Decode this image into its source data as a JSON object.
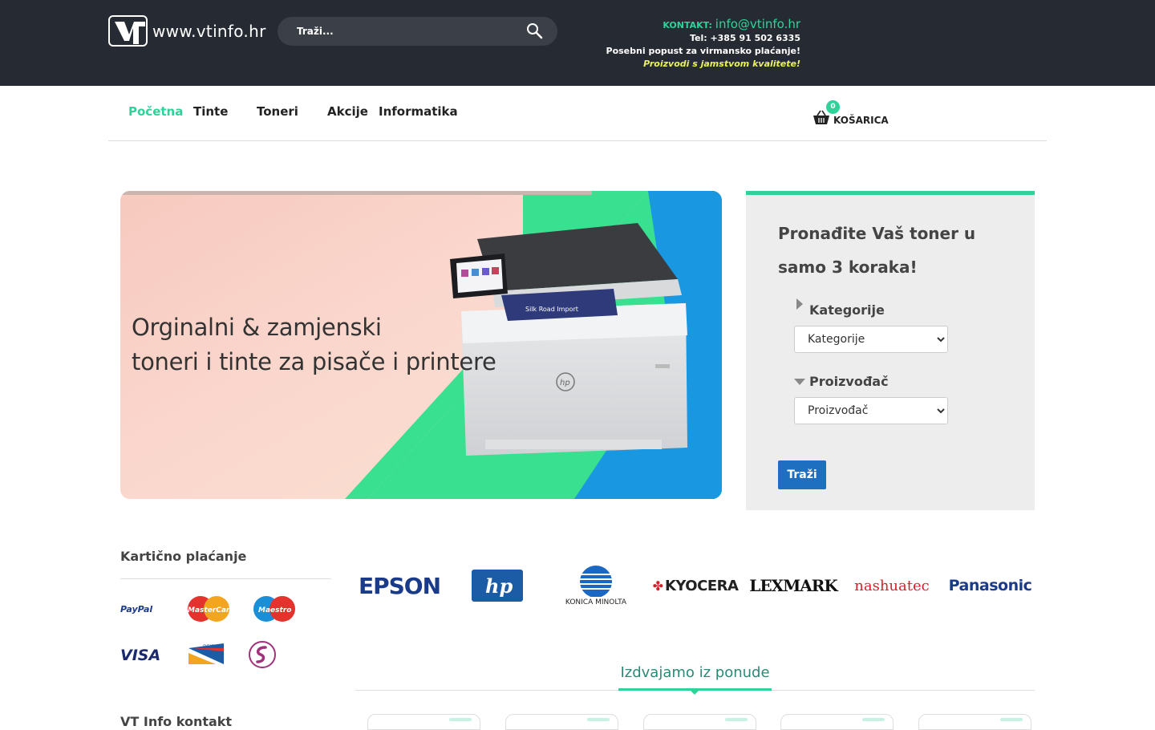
{
  "header": {
    "site_name": "www.vtinfo.hr",
    "search_placeholder": "Traži...",
    "contact_label": "KONTAKT:",
    "contact_email": "info@vtinfo.hr",
    "phone": "Tel: +385 91 502 6335",
    "promo": "Posebni popust za virmansko plaćanje!",
    "quality": "Proizvodi s jamstvom kvalitete!"
  },
  "nav": {
    "items": [
      {
        "label": "Početna",
        "active": true
      },
      {
        "label": "Tinte",
        "active": false
      },
      {
        "label": "Toneri",
        "active": false
      },
      {
        "label": "Akcije",
        "active": false
      },
      {
        "label": "Informatika",
        "active": false
      }
    ],
    "cart_count": "0",
    "cart_label": "KOŠARICA"
  },
  "banner": {
    "line1": "Orginalni & zamjenski",
    "line2": "toneri i tinte za pisače i printere",
    "printer_brand": "hp",
    "screen_text": "Silk Road Import"
  },
  "finder": {
    "title": "Pronađite Vaš toner u samo 3 koraka!",
    "category_label": "Kategorije",
    "category_value": "Kategorije",
    "maker_label": "Proizvođač",
    "maker_value": "Proizvođač",
    "search_button": "Traži"
  },
  "payments": {
    "title": "Kartično plaćanje",
    "methods": [
      "PayPal",
      "MasterCard",
      "Maestro",
      "VISA",
      "DELTA",
      "Diners"
    ]
  },
  "brands": [
    "EPSON",
    "hp",
    "KONICA MINOLTA",
    "KYOCERA",
    "LEXMARK",
    "nashuatec",
    "Panasonic"
  ],
  "featured": {
    "title": "Izdvajamo iz ponude"
  },
  "footer_contact": {
    "title": "VT Info kontakt"
  },
  "colors": {
    "header_bg": "#262b33",
    "accent": "#2fd39a",
    "button": "#1f6fc1"
  }
}
